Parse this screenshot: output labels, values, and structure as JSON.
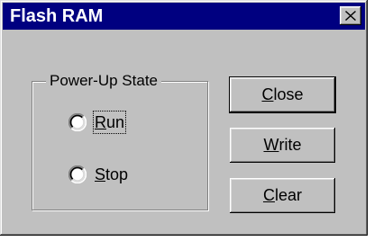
{
  "window": {
    "title": "Flash RAM",
    "close_icon": "close-icon"
  },
  "group": {
    "label": "Power-Up State",
    "options": [
      {
        "first": "R",
        "rest": "un",
        "selected": false,
        "focused": true
      },
      {
        "first": "S",
        "rest": "top",
        "selected": false,
        "focused": false
      }
    ]
  },
  "buttons": [
    {
      "first": "C",
      "rest": "lose",
      "default": true
    },
    {
      "first": "W",
      "rest": "rite",
      "default": false
    },
    {
      "first": "C",
      "rest": "lear",
      "default": false
    }
  ],
  "colors": {
    "titlebar": "#000080",
    "face": "#c0c0c0"
  }
}
